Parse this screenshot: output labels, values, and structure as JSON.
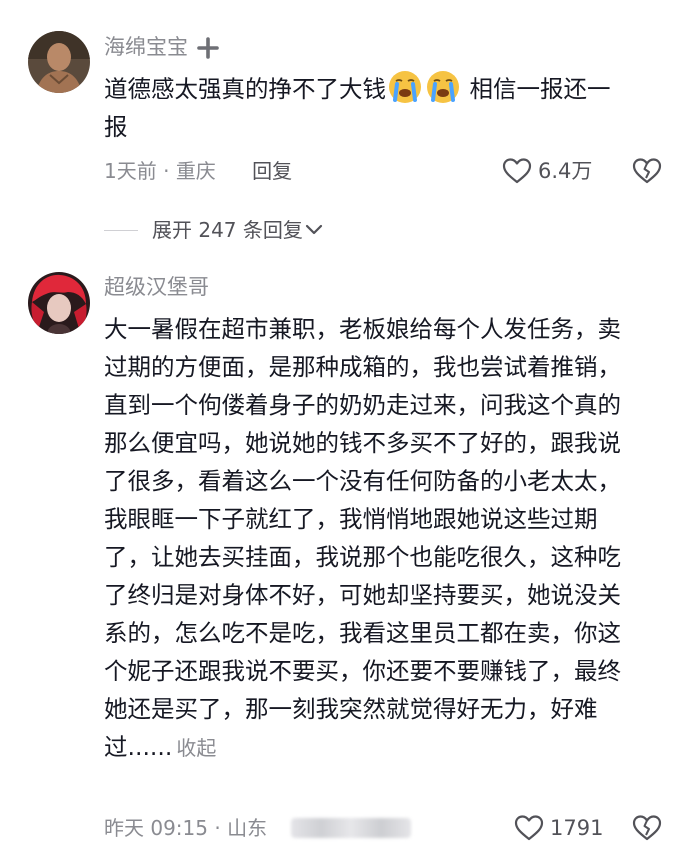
{
  "comments": [
    {
      "username": "海绵宝宝",
      "lines": [
        "道德感太强真的挣不了大钱",
        "相信一报还一",
        "报"
      ],
      "emojis": [
        "crying-face-icon",
        "crying-face-icon"
      ],
      "time": "1天前",
      "separator": "·",
      "location": "重庆",
      "reply_label": "回复",
      "likes": "6.4万"
    },
    {
      "username": "超级汉堡哥",
      "lines": [
        "大一暑假在超市兼职，老板娘给每个人发任务，卖",
        "过期的方便面，是那种成箱的，我也尝试着推销，",
        "直到一个佝偻着身子的奶奶走过来，问我这个真的",
        "那么便宜吗，她说她的钱不多买不了好的，跟我说",
        "了很多，看着这么一个没有任何防备的小老太太，",
        "我眼眶一下子就红了，我悄悄地跟她说这些过期",
        "了，让她去买挂面，我说那个也能吃很久，这种吃",
        "了终归是对身体不好，可她却坚持要买，她说没关",
        "系的，怎么吃不是吃，我看这里员工都在卖，你这",
        "个妮子还跟我说不要买，你还要不要赚钱了，最终",
        "她还是买了，那一刻我突然就觉得好无力，好难",
        "过......"
      ],
      "collapse_label": "收起",
      "time": "昨天 09:15",
      "separator": "·",
      "location": "山东",
      "likes": "1791"
    }
  ],
  "expand_replies_label": "展开 247 条回复",
  "colors": {
    "secondary_text": "#8a8b91",
    "primary_text": "#161823",
    "emoji_yellow": "#f6c343",
    "emoji_blue": "#4aa3ff"
  }
}
